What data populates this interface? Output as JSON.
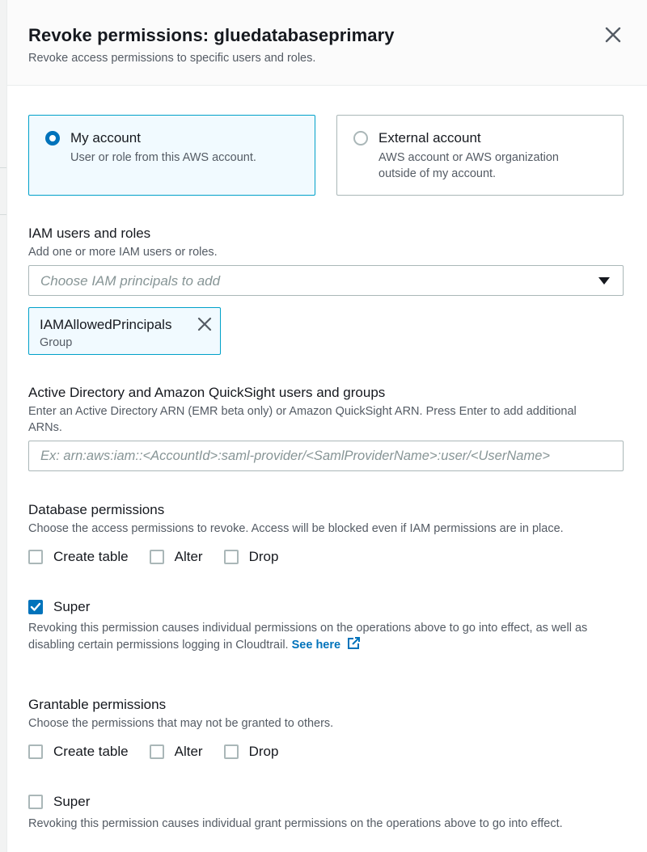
{
  "dialog": {
    "title": "Revoke permissions: gluedatabaseprimary",
    "subtitle": "Revoke access permissions to specific users and roles."
  },
  "account_choice": {
    "my_account": {
      "label": "My account",
      "description": "User or role from this AWS account.",
      "selected": true
    },
    "external_account": {
      "label": "External account",
      "description": "AWS account or AWS organization outside of my account.",
      "selected": false
    }
  },
  "iam": {
    "label": "IAM users and roles",
    "description": "Add one or more IAM users or roles.",
    "placeholder": "Choose IAM principals to add",
    "selected_token": {
      "name": "IAMAllowedPrincipals",
      "type": "Group"
    }
  },
  "active_directory": {
    "label": "Active Directory and Amazon QuickSight users and groups",
    "description": "Enter an Active Directory ARN (EMR beta only) or Amazon QuickSight ARN. Press Enter to add additional ARNs.",
    "placeholder": "Ex: arn:aws:iam::<AccountId>:saml-provider/<SamlProviderName>:user/<UserName>"
  },
  "database_permissions": {
    "label": "Database permissions",
    "description": "Choose the access permissions to revoke. Access will be blocked even if IAM permissions are in place.",
    "options": [
      {
        "label": "Create table",
        "checked": false
      },
      {
        "label": "Alter",
        "checked": false
      },
      {
        "label": "Drop",
        "checked": false
      }
    ],
    "super": {
      "label": "Super",
      "checked": true,
      "description": "Revoking this permission causes individual permissions on the operations above to go into effect, as well as disabling certain permissions logging in Cloudtrail.",
      "link_text": "See here"
    }
  },
  "grantable_permissions": {
    "label": "Grantable permissions",
    "description": "Choose the permissions that may not be granted to others.",
    "options": [
      {
        "label": "Create table",
        "checked": false
      },
      {
        "label": "Alter",
        "checked": false
      },
      {
        "label": "Drop",
        "checked": false
      }
    ],
    "super": {
      "label": "Super",
      "checked": false,
      "description": "Revoking this permission causes individual grant permissions on the operations above to go into effect."
    }
  },
  "colors": {
    "accent": "#0073bb",
    "selected_border": "#00a1c9",
    "selected_bg": "#f1faff",
    "text": "#16191f",
    "secondary_text": "#545b64"
  }
}
